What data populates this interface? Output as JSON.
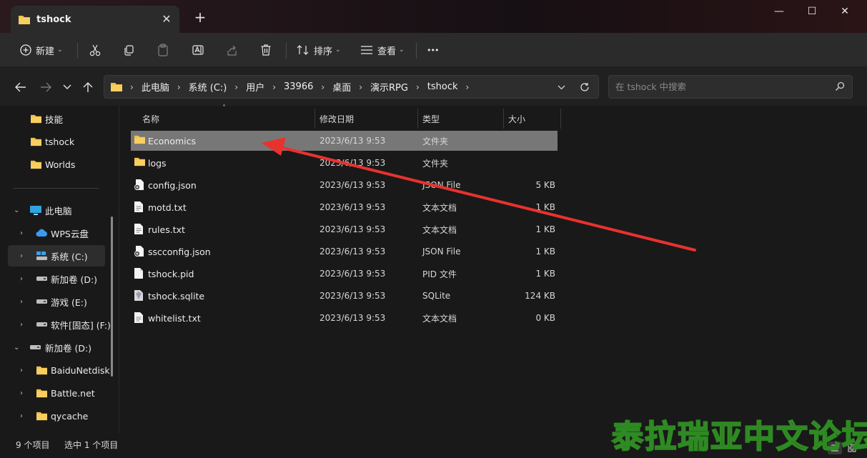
{
  "window": {
    "tab_title": "tshock",
    "close_tab_glyph": "✕",
    "new_tab_glyph": "+",
    "controls": {
      "minimize": "—",
      "maximize": "☐",
      "close": "✕"
    }
  },
  "toolbar": {
    "new_label": "新建",
    "sort_label": "排序",
    "view_label": "查看",
    "more_glyph": "•••"
  },
  "address": {
    "breadcrumbs": [
      "此电脑",
      "系统 (C:)",
      "用户",
      "33966",
      "桌面",
      "演示RPG",
      "tshock"
    ],
    "search_placeholder": "在 tshock 中搜索"
  },
  "sidebar": {
    "quick": [
      {
        "label": "技能",
        "icon": "folder-icon"
      },
      {
        "label": "tshock",
        "icon": "folder-icon"
      },
      {
        "label": "Worlds",
        "icon": "folder-icon"
      }
    ],
    "this_pc": {
      "label": "此电脑",
      "icon": "computer-icon"
    },
    "drives": [
      {
        "label": "WPS云盘",
        "icon": "cloud-icon"
      },
      {
        "label": "系统 (C:)",
        "icon": "system-drive-icon"
      },
      {
        "label": "新加卷 (D:)",
        "icon": "drive-icon"
      },
      {
        "label": "游戏 (E:)",
        "icon": "drive-icon"
      },
      {
        "label": "软件[固态] (F:)",
        "icon": "drive-icon"
      }
    ],
    "d_drive": {
      "label": "新加卷 (D:)",
      "icon": "drive-icon"
    },
    "d_children": [
      {
        "label": "BaiduNetdisk",
        "icon": "folder-icon"
      },
      {
        "label": "Battle.net",
        "icon": "folder-icon"
      },
      {
        "label": "qycache",
        "icon": "folder-icon"
      }
    ]
  },
  "columns": {
    "name": "名称",
    "date": "修改日期",
    "type": "类型",
    "size": "大小"
  },
  "files": [
    {
      "name": "Economics",
      "date": "2023/6/13 9:53",
      "type": "文件夹",
      "size": "",
      "icon": "folder-icon"
    },
    {
      "name": "logs",
      "date": "2023/6/13 9:53",
      "type": "文件夹",
      "size": "",
      "icon": "folder-icon"
    },
    {
      "name": "config.json",
      "date": "2023/6/13 9:53",
      "type": "JSON File",
      "size": "5 KB",
      "icon": "json-file-icon"
    },
    {
      "name": "motd.txt",
      "date": "2023/6/13 9:53",
      "type": "文本文档",
      "size": "1 KB",
      "icon": "text-file-icon"
    },
    {
      "name": "rules.txt",
      "date": "2023/6/13 9:53",
      "type": "文本文档",
      "size": "1 KB",
      "icon": "text-file-icon"
    },
    {
      "name": "sscconfig.json",
      "date": "2023/6/13 9:53",
      "type": "JSON File",
      "size": "1 KB",
      "icon": "json-file-icon"
    },
    {
      "name": "tshock.pid",
      "date": "2023/6/13 9:53",
      "type": "PID 文件",
      "size": "1 KB",
      "icon": "blank-file-icon"
    },
    {
      "name": "tshock.sqlite",
      "date": "2023/6/13 9:53",
      "type": "SQLite",
      "size": "124 KB",
      "icon": "database-file-icon"
    },
    {
      "name": "whitelist.txt",
      "date": "2023/6/13 9:53",
      "type": "文本文档",
      "size": "0 KB",
      "icon": "text-file-icon"
    }
  ],
  "status": {
    "item_count": "9 个项目",
    "selected": "选中 1 个项目"
  },
  "watermark": "泰拉瑞亚中文论坛",
  "colors": {
    "selection": "#777777",
    "folder": "#f2c04c",
    "annotation": "#e8322e",
    "accent": "#0a84d6"
  }
}
